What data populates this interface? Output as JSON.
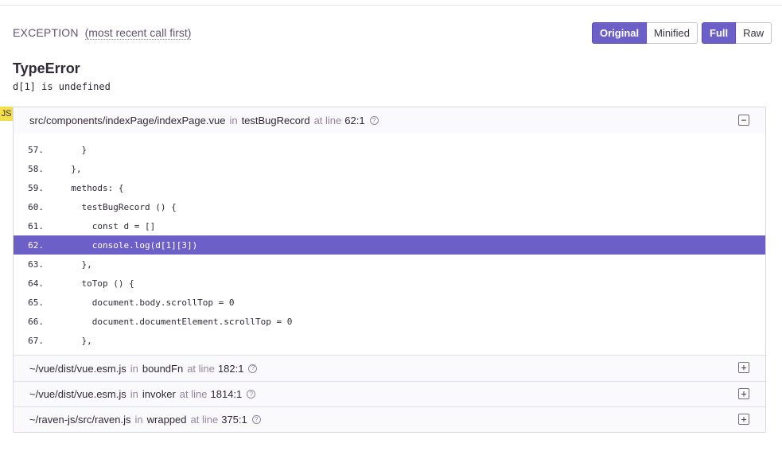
{
  "exception": {
    "title": "Exception",
    "subtitle": "(most recent call first)",
    "type": "TypeError",
    "value": "d[1] is undefined"
  },
  "toolbar": {
    "original_label": "Original",
    "minified_label": "Minified",
    "full_label": "Full",
    "raw_label": "Raw"
  },
  "platform_badge": "JS",
  "frames": [
    {
      "file": "src/components/indexPage/indexPage.vue",
      "in": "in",
      "function": "testBugRecord",
      "at_line": "at line",
      "line": "62:1",
      "toggle": "−"
    },
    {
      "file": "~/vue/dist/vue.esm.js",
      "in": "in",
      "function": "boundFn",
      "at_line": "at line",
      "line": "182:1",
      "toggle": "+"
    },
    {
      "file": "~/vue/dist/vue.esm.js",
      "in": "in",
      "function": "invoker",
      "at_line": "at line",
      "line": "1814:1",
      "toggle": "+"
    },
    {
      "file": "~/raven-js/src/raven.js",
      "in": "in",
      "function": "wrapped",
      "at_line": "at line",
      "line": "375:1",
      "toggle": "+"
    }
  ],
  "code": [
    {
      "num": "57.",
      "text": "    }"
    },
    {
      "num": "58.",
      "text": "  },"
    },
    {
      "num": "59.",
      "text": "  methods: {"
    },
    {
      "num": "60.",
      "text": "    testBugRecord () {"
    },
    {
      "num": "61.",
      "text": "      const d = []"
    },
    {
      "num": "62.",
      "text": "      console.log(d[1][3])"
    },
    {
      "num": "63.",
      "text": "    },"
    },
    {
      "num": "64.",
      "text": "    toTop () {"
    },
    {
      "num": "65.",
      "text": "      document.body.scrollTop = 0"
    },
    {
      "num": "66.",
      "text": "      document.documentElement.scrollTop = 0"
    },
    {
      "num": "67.",
      "text": "    },"
    }
  ],
  "colors": {
    "accent": "#6c5fc7",
    "badge": "#f3df49"
  }
}
